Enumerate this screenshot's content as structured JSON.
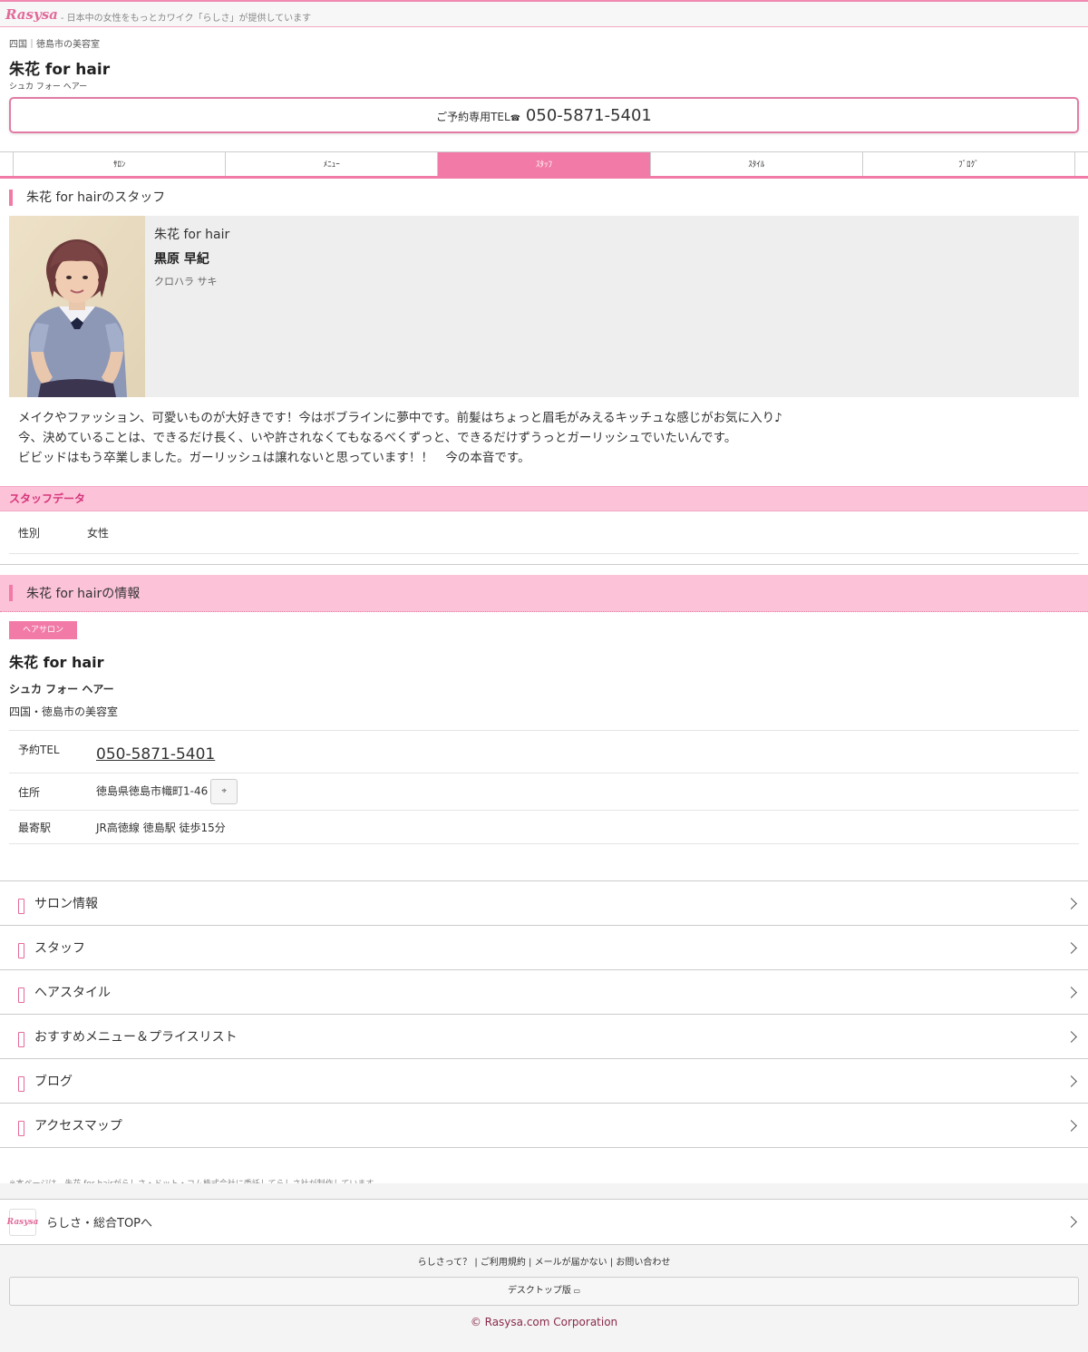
{
  "header": {
    "logo": "Rasysa",
    "tagline": "- 日本中の女性をもっとカワイク「らしさ」が提供しています"
  },
  "salon": {
    "breadcrumb": "四国｜徳島市の美容室",
    "name": "朱花 for hair",
    "kana": "シュカ フォー ヘアー",
    "tel_label": "ご予約専用TEL",
    "tel_icon": "phone-icon",
    "tel": "050-5871-5401"
  },
  "tabs": [
    {
      "label": "ｻﾛﾝ",
      "active": false
    },
    {
      "label": "ﾒﾆｭｰ",
      "active": false
    },
    {
      "label": "ｽﾀｯﾌ",
      "active": true
    },
    {
      "label": "ｽﾀｲﾙ",
      "active": false
    },
    {
      "label": "ﾌﾞﾛｸﾞ",
      "active": false
    }
  ],
  "staff_section": {
    "title": "朱花 for hairのスタッフ",
    "salon": "朱花 for hair",
    "name": "黒原 早紀",
    "kana": "クロハラ サキ",
    "description": [
      "メイクやファッション、可愛いものが大好きです！今はボブラインに夢中です。前髪はちょっと眉毛がみえるキッチュな感じがお気に入り♪",
      "今、決めていることは、できるだけ長く、いや許されなくてもなるべくずっと、できるだけずうっとガーリッシュでいたいんです。",
      "ビビッドはもう卒業しました。ガーリッシュは譲れないと思っています！！　今の本音です。"
    ],
    "data_title": "スタッフデータ",
    "data": [
      {
        "key": "性別",
        "value": "女性"
      }
    ]
  },
  "info": {
    "title": "朱花 for hairの情報",
    "badge": "ヘアサロン",
    "name": "朱花 for hair",
    "kana": "シュカ フォー ヘアー",
    "location": "四国・徳島市の美容室",
    "tel_key": "予約TEL",
    "tel": "050-5871-5401",
    "addr_key": "住所",
    "address": "徳島県徳島市幟町1-46",
    "map_icon": "map-icon",
    "station_key": "最寄駅",
    "station": "JR高徳線 徳島駅 徒歩15分"
  },
  "nav": [
    {
      "label": "サロン情報"
    },
    {
      "label": "スタッフ"
    },
    {
      "label": "ヘアスタイル"
    },
    {
      "label": "おすすめメニュー＆プライスリスト"
    },
    {
      "label": "ブログ"
    },
    {
      "label": "アクセスマップ"
    }
  ],
  "note": "※本ページは、朱花 for hairがらしさ・ドット・コム株式会社に委託してらしさ社が制作しています。",
  "footer": {
    "top_label": "らしさ・総合TOPへ",
    "mini_logo": "Rasysa",
    "links": "らしさって？ | ご利用規約 | メールが届かない | お問い合わせ",
    "desktop": "デスクトップ版",
    "copyright": "© Rasysa.com Corporation"
  },
  "colors": {
    "accent": "#f27aa6",
    "pink_bg": "#fcc2d8",
    "brand_text": "#d6367a"
  }
}
